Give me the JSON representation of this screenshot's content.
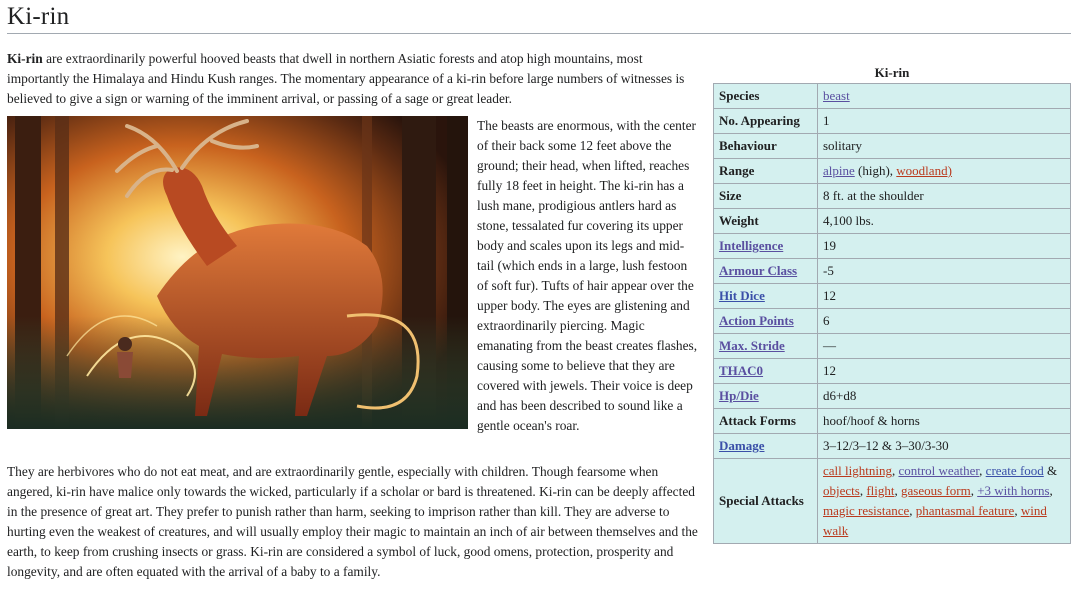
{
  "page": {
    "title": "Ki-rin",
    "intro_bold": "Ki-rin",
    "intro_rest": " are extraordinarily powerful hooved beasts that dwell in northern Asiatic forests and atop high mountains, most importantly the Himalaya and Hindu Kush ranges. The momentary appearance of a ki-rin before large numbers of witnesses is believed to give a sign or warning of the imminent arrival, or passing of a sage or great leader.",
    "side_paragraph": "The beasts are enormous, with the center of their back some 12 feet above the ground; their head, when lifted, reaches fully 18 feet in height. The ki-rin has a lush mane, prodigious antlers hard as stone, tessalated fur covering its upper body and scales upon its legs and mid-tail (which ends in a large, lush festoon of soft fur). Tufts of hair appear over the upper body. The eyes are glistening and extraordinarily piercing. Magic emanating from the beast creates flashes, causing some to believe that they are covered with jewels. Their voice is deep and has been described to sound like a gentle ocean's roar.",
    "closing_paragraph": "They are herbivores who do not eat meat, and are extraordinarily gentle, especially with children. Though fearsome when angered, ki-rin have malice only towards the wicked, particularly if a scholar or bard is threatened. Ki-rin can be deeply affected in the presence of great art. They prefer to punish rather than harm, seeking to imprison rather than kill. They are adverse to hurting even the weakest of creatures, and will usually employ their magic to maintain an inch of air between themselves and the earth, to keep from crushing insects or grass. Ki-rin are considered a symbol of luck, good omens, protection, prosperity and longevity, and are often equated with the arrival of a baby to a family."
  },
  "infobox": {
    "caption": "Ki-rin",
    "species_label": "Species",
    "species_value": "beast",
    "appearing_label": "No. Appearing",
    "appearing_value": "1",
    "behaviour_label": "Behaviour",
    "behaviour_value": "solitary",
    "range_label": "Range",
    "range_link1": "alpine",
    "range_text1": " (high), ",
    "range_link2": "woodland)",
    "size_label": "Size",
    "size_value": "8 ft. at the shoulder",
    "weight_label": "Weight",
    "weight_value": "4,100 lbs.",
    "intelligence_label": "Intelligence",
    "intelligence_value": "19",
    "armour_label": "Armour Class",
    "armour_value": "-5",
    "hitdice_label": "Hit Dice",
    "hitdice_value": "12",
    "ap_label": "Action Points",
    "ap_value": "6",
    "stride_label": "Max. Stride",
    "stride_value": "—",
    "thac0_label": "THAC0",
    "thac0_value": "12",
    "hpdie_label": "Hp/Die",
    "hpdie_value": "d6+d8",
    "attackforms_label": "Attack Forms",
    "attackforms_value": "hoof/hoof & horns",
    "damage_label": "Damage",
    "damage_value": "3–12/3–12 & 3–30/3-30",
    "special_label": "Special Attacks",
    "special": {
      "a1": "call lightning",
      "s1": ", ",
      "a2": "control weather",
      "s2": ", ",
      "a3": "create food",
      "s3": " & ",
      "a4": "objects",
      "s4": ", ",
      "a5": "flight",
      "s5": ", ",
      "a6": "gaseous form",
      "s6": ", ",
      "a7": "+3 with horns",
      "s7": ", ",
      "a8": "magic resistance",
      "s8": ", ",
      "a9": "phantasmal feature",
      "s9": ", ",
      "a10": "wind walk"
    }
  },
  "colors": {
    "infobox_bg": "#d4f0ef",
    "link_blue": "#3a4fa8",
    "link_red": "#ba3a1e"
  }
}
